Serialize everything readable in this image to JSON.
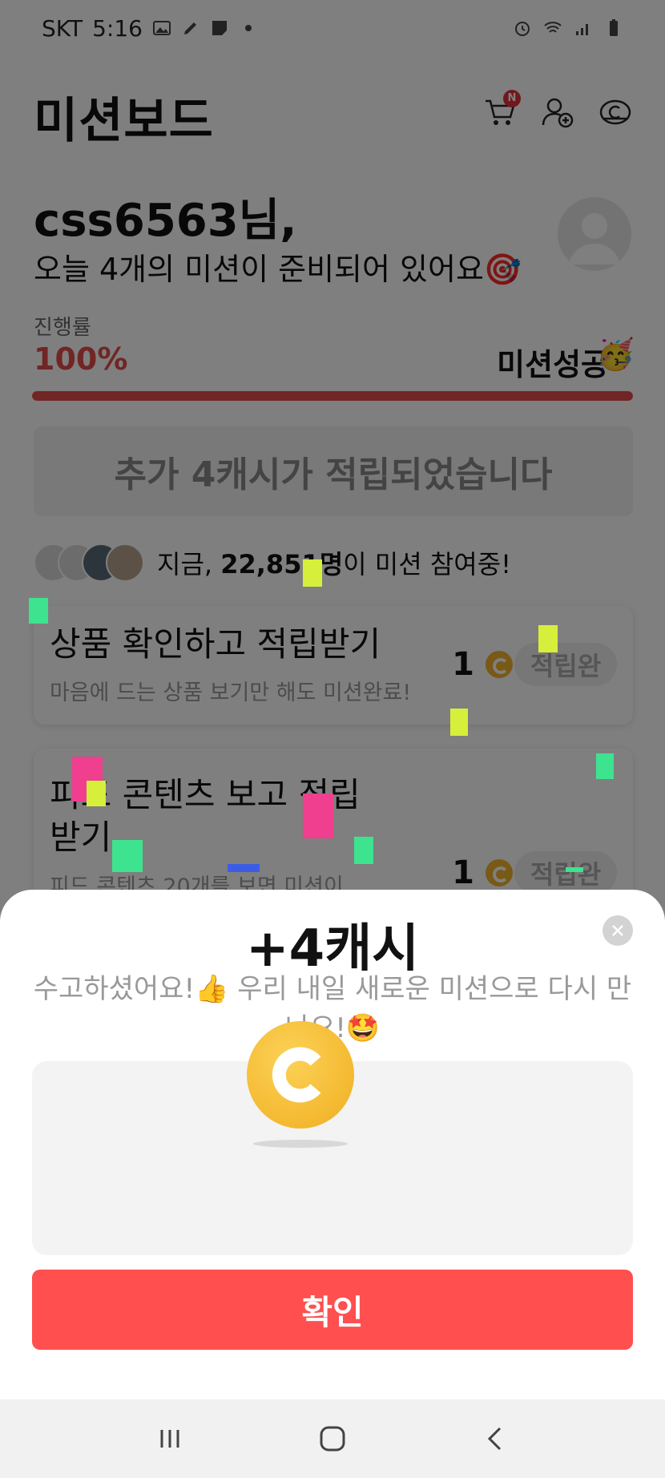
{
  "status_bar": {
    "carrier": "SKT",
    "time": "5:16",
    "icons_left": [
      "image-icon",
      "pen-icon",
      "note-icon",
      "dot-icon"
    ],
    "icons_right": [
      "alarm-icon",
      "wifi-icon",
      "signal-icon",
      "battery-icon"
    ]
  },
  "header": {
    "title": "미션보드",
    "cart_badge": "N",
    "icons": [
      "cart-icon",
      "add-friend-icon",
      "cash-icon"
    ]
  },
  "greeting": {
    "name": "css6563님,",
    "subtitle": "오늘 4개의 미션이 준비되어 있어요🎯"
  },
  "progress": {
    "label": "진행률",
    "value": "100%",
    "fraction": 1.0,
    "status": "미션성공",
    "status_emoji": "🥳"
  },
  "banner": {
    "text": "추가 4캐시가 적립되었습니다"
  },
  "participants": {
    "prefix": "지금, ",
    "count": "22,851명",
    "suffix": "이 미션 참여중!"
  },
  "missions": [
    {
      "title": "상품 확인하고 적립받기",
      "desc": "마음에 드는 상품 보기만 해도 미션완료!",
      "reward": "1",
      "status": "적립완"
    },
    {
      "title": "피드 콘텐츠 보고 적립받기",
      "desc": "피드 콘텐츠 20개를 보면 미션이",
      "reward": "1",
      "status": "적립완"
    }
  ],
  "sheet": {
    "title": "+4캐시",
    "message": "수고하셨어요!👍 우리 내일 새로운 미션으로 다시 만나요!🤩",
    "confirm": "확인"
  },
  "nav": [
    "recents-icon",
    "home-icon",
    "back-icon"
  ],
  "colors": {
    "accent": "#ff4f4f",
    "progress": "#e24a4a",
    "coin": "#f0b22c"
  }
}
